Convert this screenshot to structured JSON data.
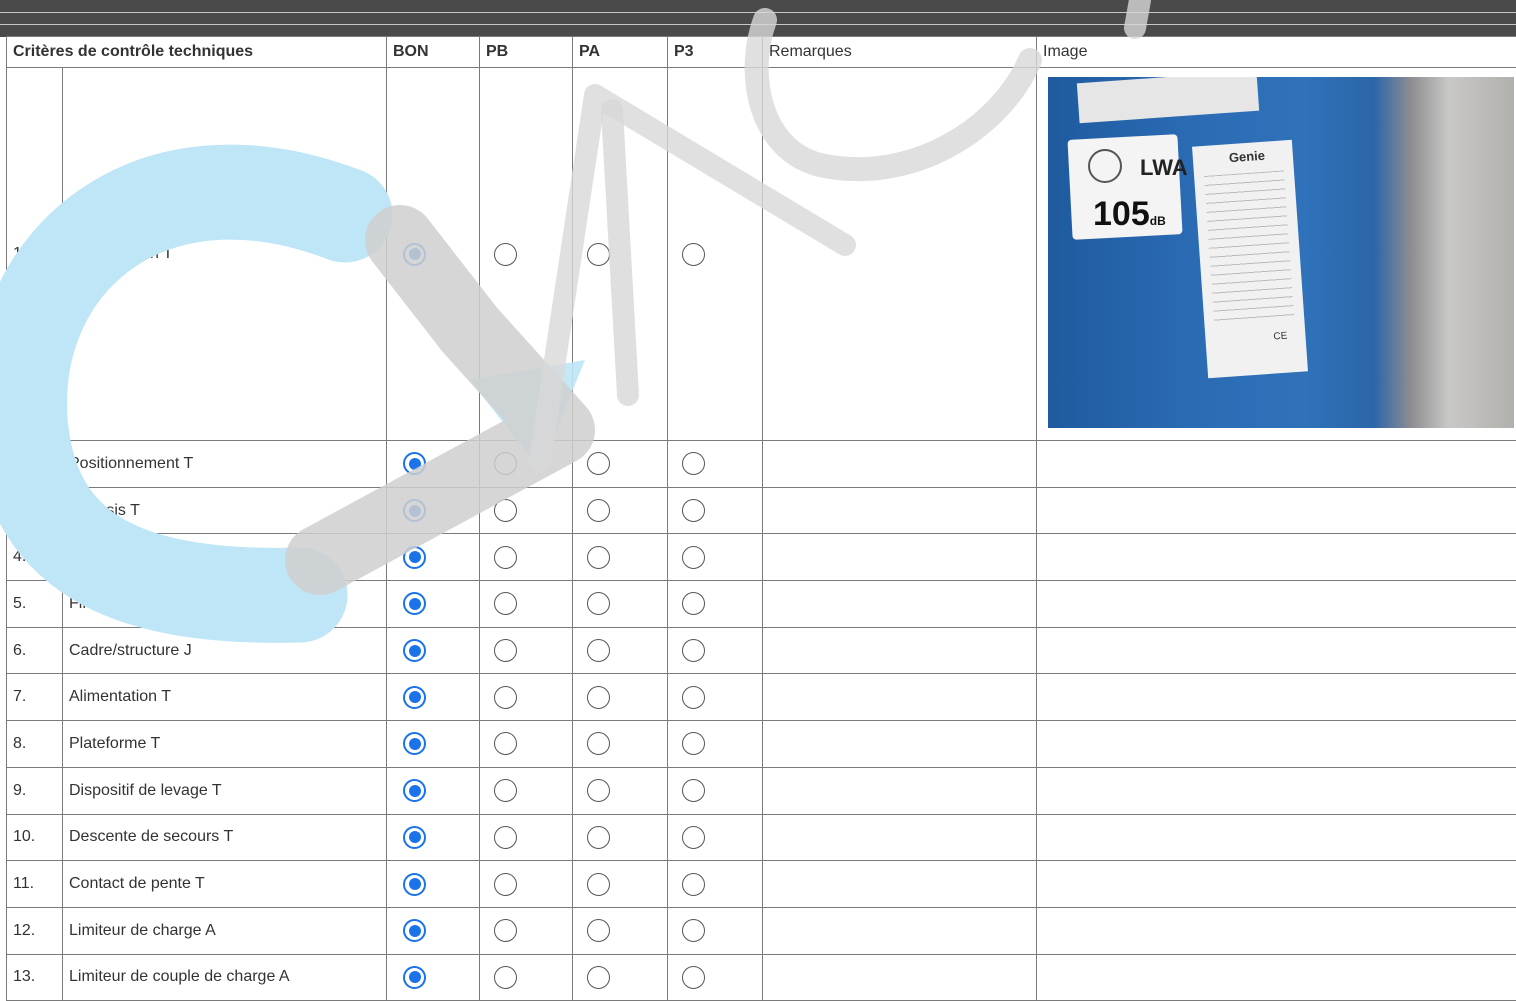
{
  "table": {
    "headers": {
      "criteria": "Critères de contrôle techniques",
      "bon": "BON",
      "pb": "PB",
      "pa": "PA",
      "p3": "P3",
      "remarks": "Remarques",
      "image": "Image"
    },
    "rows": [
      {
        "num": "1.",
        "label": "Identification T",
        "selected": "BON"
      },
      {
        "num": "2.",
        "label": "Positionnement T",
        "selected": "BON"
      },
      {
        "num": "3.",
        "label": "Châssis T",
        "selected": "BON"
      },
      {
        "num": "4.",
        "label": "Commande en bas T",
        "selected": "BON"
      },
      {
        "num": "5.",
        "label": "Fin de course T",
        "selected": "BON"
      },
      {
        "num": "6.",
        "label": "Cadre/structure J",
        "selected": "BON"
      },
      {
        "num": "7.",
        "label": "Alimentation T",
        "selected": "BON"
      },
      {
        "num": "8.",
        "label": "Plateforme T",
        "selected": "BON"
      },
      {
        "num": "9.",
        "label": "Dispositif de levage T",
        "selected": "BON"
      },
      {
        "num": "10.",
        "label": "Descente de secours T",
        "selected": "BON"
      },
      {
        "num": "11.",
        "label": "Contact de pente T",
        "selected": "BON"
      },
      {
        "num": "12.",
        "label": "Limiteur de charge A",
        "selected": "BON"
      },
      {
        "num": "13.",
        "label": "Limiteur de couple de charge A",
        "selected": "BON"
      }
    ]
  },
  "photo": {
    "lwa_label": "LWA",
    "db_value": "105",
    "db_unit": "dB",
    "brand": "Genie",
    "ce_mark": "CE"
  },
  "colors": {
    "accent": "#1a73e8",
    "topbar": "#4a4a4a",
    "watermark_blue": "#bfe6f6",
    "watermark_gray": "#d4d4d4"
  }
}
